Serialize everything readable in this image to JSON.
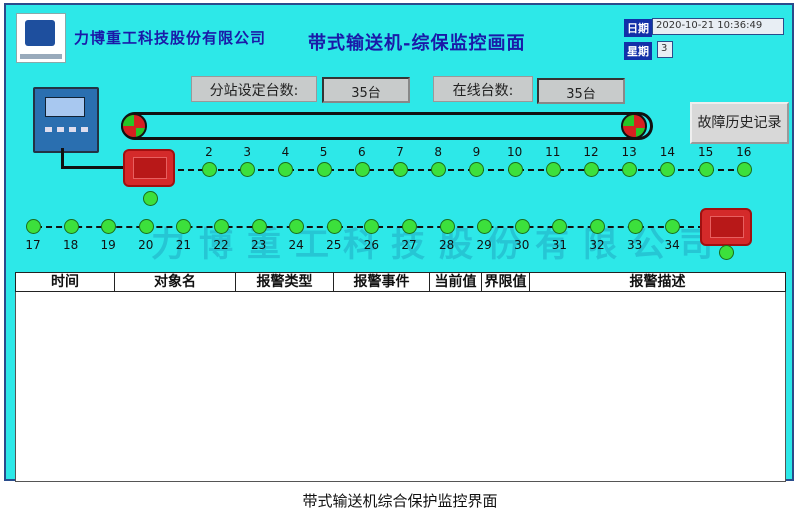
{
  "header": {
    "company": "力博重工科技股份有限公司",
    "title": "带式输送机-综保监控画面",
    "date_label": "日期",
    "date_value": "2020-10-21 10:36:49",
    "week_label": "星期",
    "week_value": "3"
  },
  "stats": {
    "substation_label": "分站设定台数:",
    "substation_value": "35台",
    "online_label": "在线台数:",
    "online_value": "35台"
  },
  "history_button": "故障历史记录",
  "nodes_row1": [
    "2",
    "3",
    "4",
    "5",
    "6",
    "7",
    "8",
    "9",
    "10",
    "11",
    "12",
    "13",
    "14",
    "15",
    "16"
  ],
  "nodes_row2": [
    "17",
    "18",
    "19",
    "20",
    "21",
    "22",
    "23",
    "24",
    "25",
    "26",
    "27",
    "28",
    "29",
    "30",
    "31",
    "32",
    "33",
    "34"
  ],
  "watermark": "力博重工科技股份有限公司",
  "table": {
    "columns": [
      "时间",
      "对象名",
      "报警类型",
      "报警事件",
      "当前值",
      "界限值",
      "报警描述"
    ]
  },
  "caption": "带式输送机综合保护监控界面",
  "colors": {
    "background": "#2de8e8",
    "node": "#3ce03c",
    "pulley": "#d62020",
    "title_text": "#1a1aa8"
  }
}
